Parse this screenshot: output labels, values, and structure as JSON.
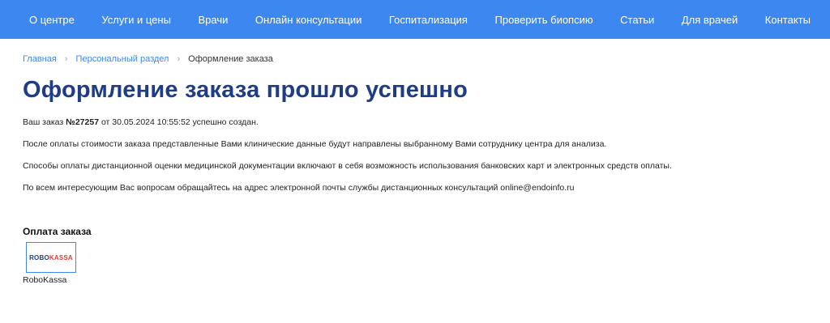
{
  "nav": {
    "items": [
      "О центре",
      "Услуги и цены",
      "Врачи",
      "Онлайн консультации",
      "Госпитализация",
      "Проверить биопсию",
      "Статьи",
      "Для врачей",
      "Контакты"
    ]
  },
  "breadcrumb": {
    "home": "Главная",
    "personal": "Персональный раздел",
    "current": "Оформление заказа",
    "separator": "›"
  },
  "page": {
    "title": "Оформление заказа прошло успешно",
    "order_prefix": "Ваш заказ ",
    "order_number": "№27257",
    "order_suffix": " от 30.05.2024 10:55:52 успешно создан.",
    "para2": "После оплаты стоимости заказа представленные Вами клинические данные будут направлены выбранному Вами сотруднику центра для анализа.",
    "para3": "Способы оплаты дистанционной оценки медицинской документации включают в себя возможность использования банковских карт и электронных средств оплаты.",
    "para4": "По всем интересующим Вас вопросам обращайтесь на адрес электронной почты службы дистанционных консультаций online@endoinfo.ru"
  },
  "payment": {
    "heading": "Оплата заказа",
    "logo_part1": "ROBO",
    "logo_part2": "KASSA",
    "method_label": "RoboKassa"
  },
  "colors": {
    "nav_bg": "#3d88f0",
    "title": "#1f3c88",
    "link": "#3d88f0",
    "robokassa_red": "#e53935"
  }
}
